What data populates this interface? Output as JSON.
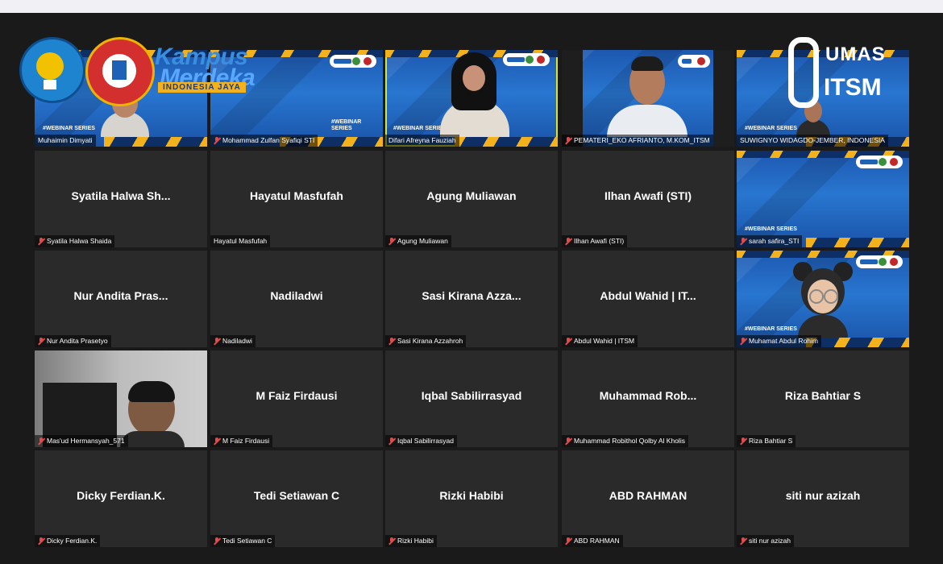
{
  "overlay": {
    "campaign_line1": "Kampus",
    "campaign_line2": "Merdeka",
    "campaign_tag": "INDONESIA JAYA",
    "watermark_line1": "UMAS",
    "watermark_line2": "ITSM",
    "left_logo_1_text": "TUT WURI HANDAYANI"
  },
  "banner": {
    "series": "#WEBINAR SERIES"
  },
  "participants": [
    {
      "display": "",
      "label": "Muhaimin Dimyati",
      "muted": false,
      "video": true
    },
    {
      "display": "",
      "label": "Mohammad Zulfan Syafiqi STI",
      "muted": false,
      "video": true
    },
    {
      "display": "",
      "label": "Difari Afreyna Fauziah",
      "muted": false,
      "video": true,
      "active": true
    },
    {
      "display": "",
      "label": "PEMATERI_EKO AFRIANTO, M.KOM_ITSM",
      "muted": true,
      "video": true
    },
    {
      "display": "",
      "label": "SUWIGNYO WIDAGDO-JEMBER, INDONESIA",
      "muted": false,
      "video": true
    },
    {
      "display": "Syatila Halwa Sh...",
      "label": "Syatila Halwa Shaida",
      "muted": true
    },
    {
      "display": "Hayatul Masfufah",
      "label": "Hayatul Masfufah",
      "muted": false
    },
    {
      "display": "Agung Muliawan",
      "label": "Agung Muliawan",
      "muted": true
    },
    {
      "display": "Ilhan Awafi (STI)",
      "label": "Ilhan Awafi (STI)",
      "muted": true
    },
    {
      "display": "",
      "label": "sarah safira_STI",
      "muted": true,
      "video": true
    },
    {
      "display": "Nur Andita Pras...",
      "label": "Nur Andita Prasetyo",
      "muted": true
    },
    {
      "display": "Nadiladwi",
      "label": "Nadiladwi",
      "muted": true
    },
    {
      "display": "Sasi Kirana Azza...",
      "label": "Sasi Kirana Azzahroh",
      "muted": true
    },
    {
      "display": "Abdul Wahid | IT...",
      "label": "Abdul Wahid | ITSM",
      "muted": true
    },
    {
      "display": "",
      "label": "Muhamat Abdul Rohim",
      "muted": true,
      "video": true
    },
    {
      "display": "",
      "label": "Mas'ud Hermansyah_571",
      "muted": true,
      "video": true
    },
    {
      "display": "M Faiz Firdausi",
      "label": "M Faiz Firdausi",
      "muted": true
    },
    {
      "display": "Iqbal Sabilirrasyad",
      "label": "Iqbal Sabilirrasyad",
      "muted": true
    },
    {
      "display": "Muhammad  Rob...",
      "label": "Muhammad Robithol Qolby Al Kholis",
      "muted": true
    },
    {
      "display": "Riza Bahtiar S",
      "label": "Riza Bahtiar S",
      "muted": true
    },
    {
      "display": "Dicky Ferdian.K.",
      "label": "Dicky Ferdian.K.",
      "muted": true
    },
    {
      "display": "Tedi Setiawan C",
      "label": "Tedi Setiawan C",
      "muted": true
    },
    {
      "display": "Rizki Habibi",
      "label": "Rizki Habibi",
      "muted": true
    },
    {
      "display": "ABD RAHMAN",
      "label": "ABD RAHMAN",
      "muted": true
    },
    {
      "display": "siti nur azizah",
      "label": "siti nur azizah",
      "muted": true
    }
  ]
}
